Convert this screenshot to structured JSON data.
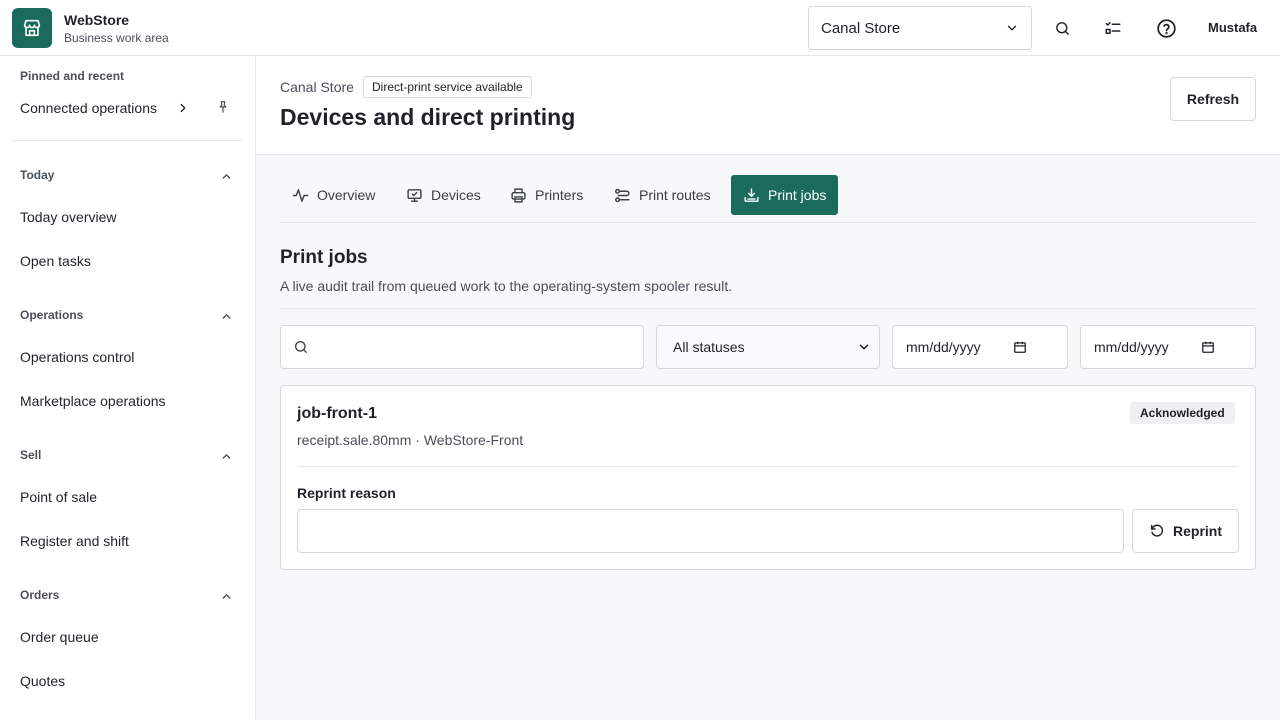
{
  "app": {
    "name": "WebStore",
    "subtitle": "Business work area"
  },
  "topbar": {
    "store_select": "Canal Store",
    "user": "Mustafa",
    "icons": [
      "search-icon",
      "checklist-icon",
      "help-icon"
    ]
  },
  "sidebar": {
    "pinned_heading": "Pinned and recent",
    "pinned_item": "Connected operations",
    "groups": [
      {
        "heading": "Today",
        "items": [
          "Today overview",
          "Open tasks"
        ]
      },
      {
        "heading": "Operations",
        "items": [
          "Operations control",
          "Marketplace operations"
        ]
      },
      {
        "heading": "Sell",
        "items": [
          "Point of sale",
          "Register and shift"
        ]
      },
      {
        "heading": "Orders",
        "items": [
          "Order queue",
          "Quotes"
        ]
      }
    ]
  },
  "header": {
    "breadcrumb": "Canal Store",
    "service_badge": "Direct-print service available",
    "title": "Devices and direct printing",
    "refresh_label": "Refresh"
  },
  "tabs": [
    {
      "label": "Overview",
      "icon": "activity-icon"
    },
    {
      "label": "Devices",
      "icon": "monitor-icon"
    },
    {
      "label": "Printers",
      "icon": "printer-icon"
    },
    {
      "label": "Print routes",
      "icon": "routes-icon"
    },
    {
      "label": "Print jobs",
      "icon": "download-tray-icon",
      "active": true
    }
  ],
  "section": {
    "title": "Print jobs",
    "description": "A live audit trail from queued work to the operating-system spooler result."
  },
  "filters": {
    "search_value": "",
    "status_select": "All statuses",
    "date_from_placeholder": "mm/dd/yyyy",
    "date_to_placeholder": "mm/dd/yyyy"
  },
  "jobs": [
    {
      "id": "job-front-1",
      "meta": "receipt.sale.80mm · WebStore-Front",
      "status": "Acknowledged",
      "reprint_label": "Reprint reason",
      "reprint_value": "",
      "reprint_button": "Reprint"
    }
  ],
  "colors": {
    "accent": "#1a6b5c",
    "border": "#d4d8dd",
    "main_bg": "#f6f8fa"
  }
}
